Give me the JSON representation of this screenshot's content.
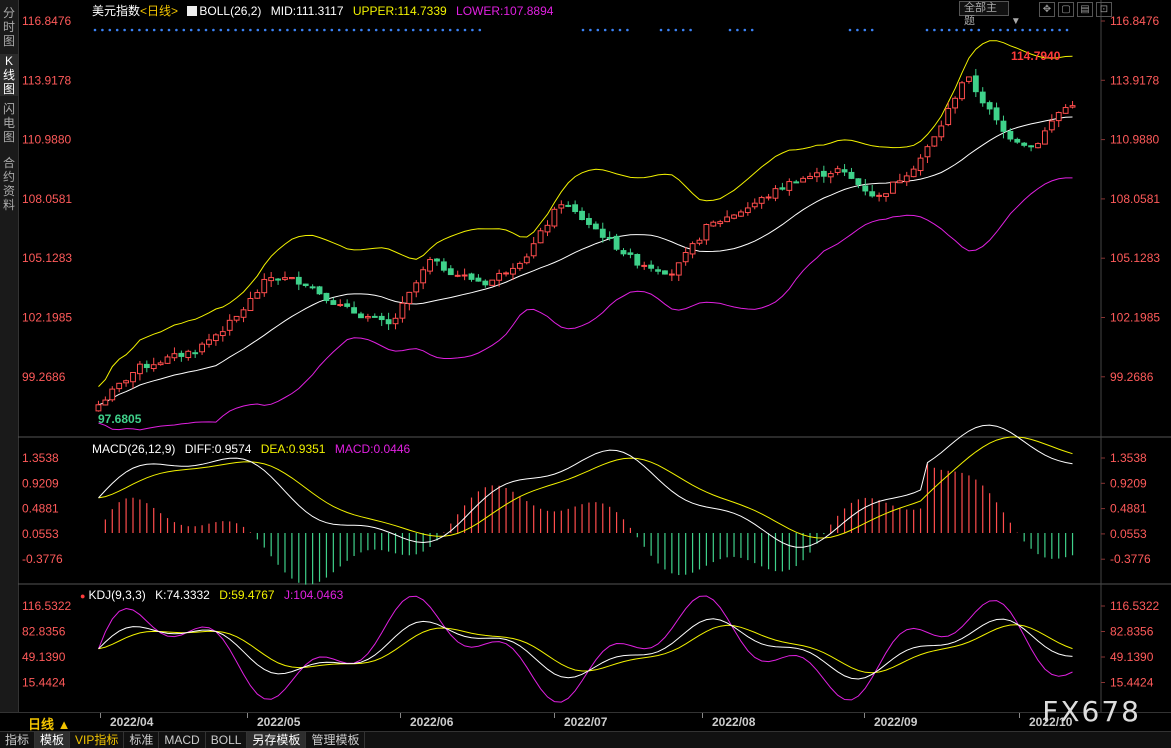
{
  "left_tabs": [
    {
      "label": "分时图",
      "active": false
    },
    {
      "label": "K线图",
      "active": true
    },
    {
      "label": "闪电图",
      "active": false
    },
    {
      "label": "合约资料",
      "active": false
    }
  ],
  "header": {
    "name": "美元指数",
    "period_tag": "<日线>",
    "boll_label": "BOLL(26,2)",
    "mid": "MID:111.3117",
    "upper": "UPPER:114.7339",
    "lower": "LOWER:107.8894"
  },
  "theme_select": "全部主题",
  "main_axis_labels": [
    "116.8476",
    "113.9178",
    "110.9880",
    "108.0581",
    "105.1283",
    "102.1985",
    "99.2686"
  ],
  "high_label": "114.7940",
  "low_label": "97.6805",
  "macd_header": {
    "name": "MACD(26,12,9)",
    "diff": "DIFF:0.9574",
    "dea": "DEA:0.9351",
    "macd": "MACD:0.0446"
  },
  "macd_axis_labels": [
    "1.3538",
    "0.9209",
    "0.4881",
    "0.0553",
    "-0.3776"
  ],
  "kdj_header": {
    "name": "KDJ(9,3,3)",
    "k": "K:74.3332",
    "d": "D:59.4767",
    "j": "J:104.0463"
  },
  "kdj_axis_labels": [
    "116.5322",
    "82.8356",
    "49.1390",
    "15.4424"
  ],
  "dates": [
    "2022/04",
    "2022/05",
    "2022/06",
    "2022/07",
    "2022/08",
    "2022/09",
    "2022/10"
  ],
  "period_button": "日线 ▲",
  "bottom_tabs": [
    {
      "label": "指标"
    },
    {
      "label": "模板",
      "active": true
    },
    {
      "label": "VIP指标",
      "vip": true
    },
    {
      "label": "标准"
    },
    {
      "label": "MACD"
    },
    {
      "label": "BOLL"
    },
    {
      "label": "另存模板",
      "active": true
    },
    {
      "label": "管理模板"
    }
  ],
  "watermark": "FX678",
  "colors": {
    "up": "#ff4d4d",
    "down": "#3fd18a",
    "mid": "#ffffff",
    "upper": "#f2f200",
    "lower": "#e020e0",
    "axis_text": "#ff5a5a",
    "diff": "#ffffff",
    "dea": "#f2f200",
    "k": "#ffffff",
    "d": "#f2f200",
    "j": "#e020e0",
    "grid": "#6a0000"
  }
}
